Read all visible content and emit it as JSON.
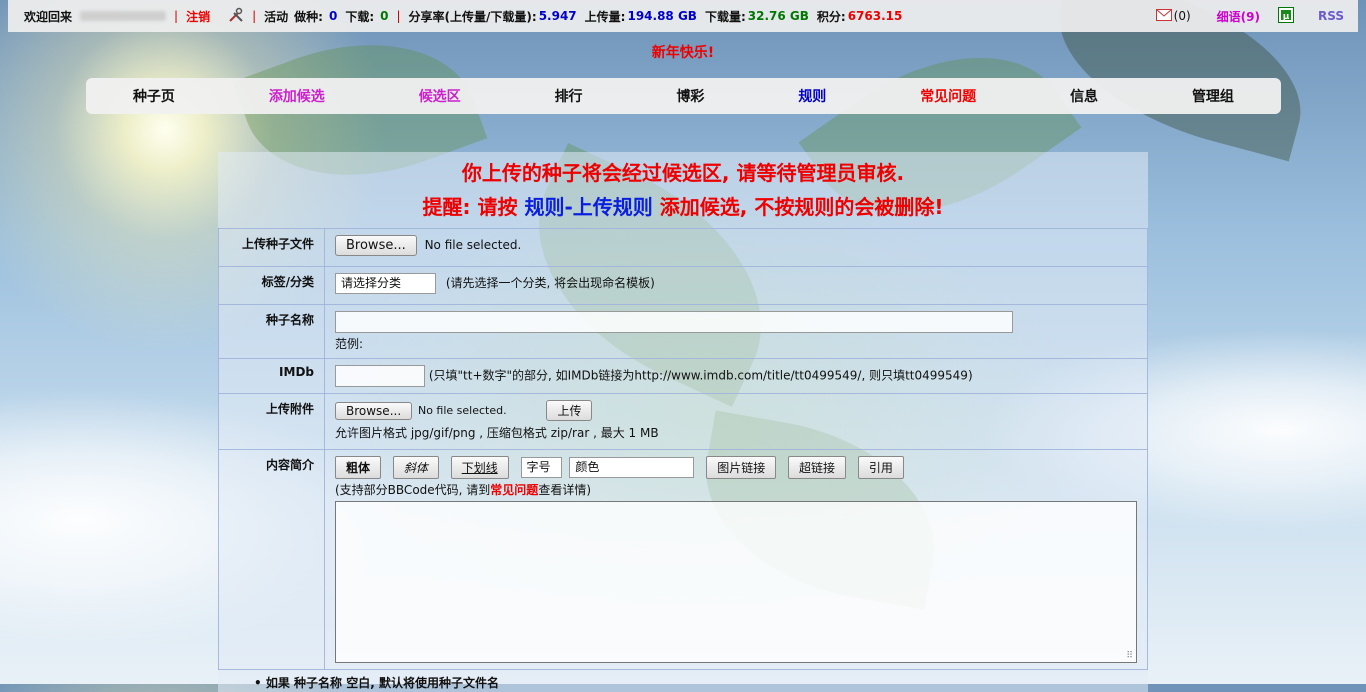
{
  "topbar": {
    "welcome": "欢迎回来",
    "logout": "注销",
    "activity_label": "活动",
    "seeding_label": "做种:",
    "seeding": "0",
    "downloading_label": "下载:",
    "downloading": "0",
    "ratio_label": "分享率(上传量/下载量):",
    "ratio": "5.947",
    "uploaded_label": "上传量:",
    "uploaded": "194.88 GB",
    "downloaded_label": "下载量:",
    "downloaded": "32.76 GB",
    "points_label": "积分:",
    "points": "6763.15",
    "mail_count": "(0)",
    "messages": "细语(9)",
    "rss": "RSS"
  },
  "motto": "新年快乐!",
  "nav": [
    "种子页",
    "添加候选",
    "候选区",
    "排行",
    "博彩",
    "规则",
    "常见问题",
    "信息",
    "管理组"
  ],
  "notice": {
    "line1": "你上传的种子将会经过候选区, 请等待管理员审核.",
    "line2_prefix": "提醒: 请按",
    "line2_link": "规则-上传规则",
    "line2_suffix": "添加候选, 不按规则的会被删除!"
  },
  "form": {
    "torrent_label": "上传种子文件",
    "browse": "Browse...",
    "no_file": "No file selected.",
    "tag_label": "标签/分类",
    "tag_select": "请选择分类",
    "tag_hint": "(请先选择一个分类, 将会出现命名模板)",
    "name_label": "种子名称",
    "name_example": "范例:",
    "imdb_label": "IMDb",
    "imdb_hint": "(只填\"tt+数字\"的部分, 如IMDb链接为http://www.imdb.com/title/tt0499549/, 则只填tt0499549)",
    "attach_label": "上传附件",
    "attach_browse": "Browse...",
    "attach_no_file": "No file selected.",
    "attach_upload": "上传",
    "attach_hint": "允许图片格式 jpg/gif/png , 压缩包格式 zip/rar , 最大 1 MB",
    "desc_label": "内容简介",
    "bb_bold": "粗体",
    "bb_italic": "斜体",
    "bb_underline": "下划线",
    "bb_size": "字号",
    "bb_color": "颜色",
    "bb_image": "图片链接",
    "bb_link": "超链接",
    "bb_quote": "引用",
    "bb_hint_prefix": "(支持部分BBCode代码, 请到",
    "bb_hint_link": "常见问题",
    "bb_hint_suffix": "查看详情)"
  },
  "bottom_note": "• 如果 种子名称 空白, 默认将使用种子文件名"
}
